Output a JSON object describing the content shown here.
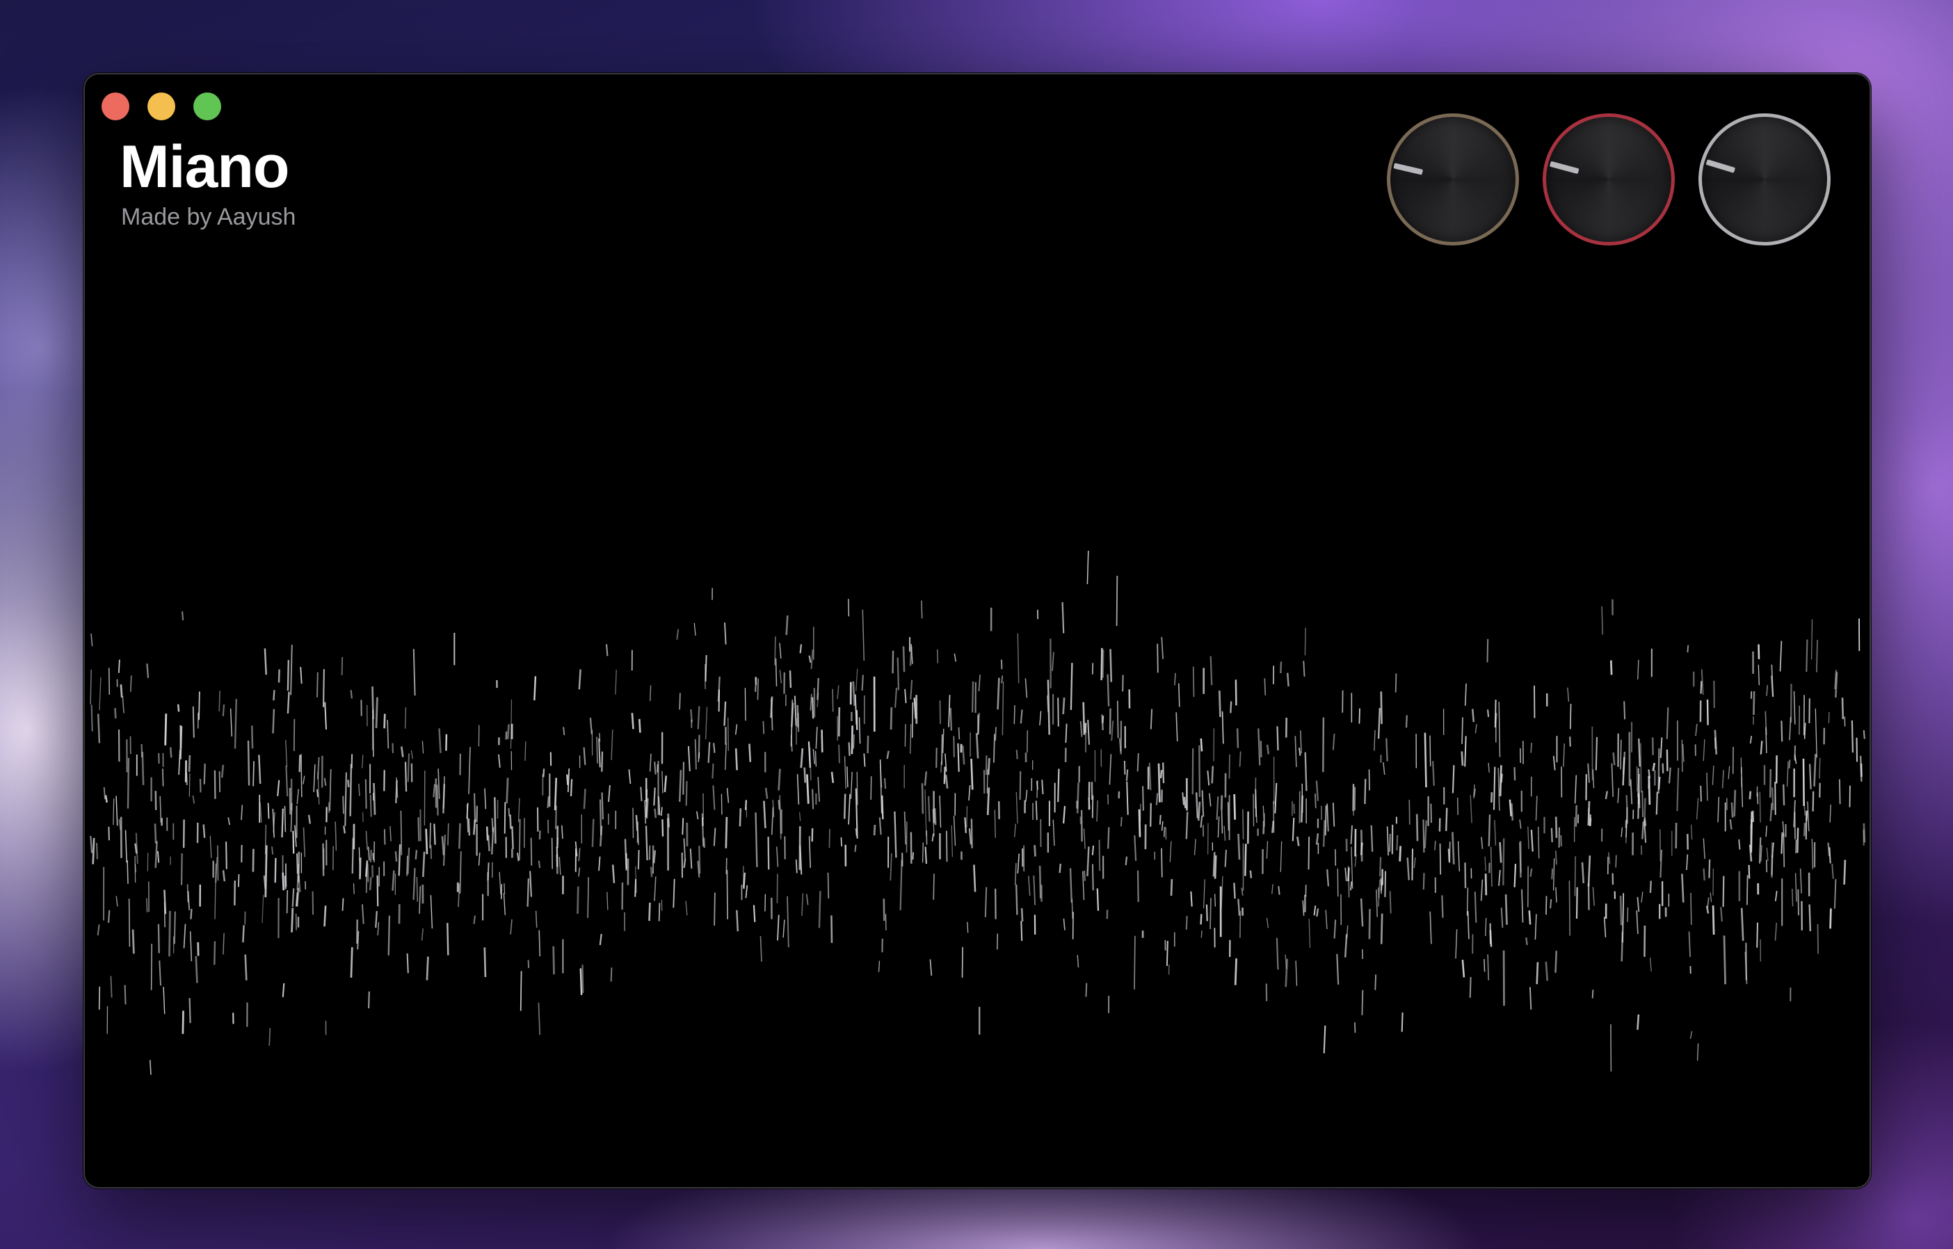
{
  "window": {
    "title": "Miano",
    "subtitle": "Made by Aayush"
  },
  "traffic_lights": [
    "close",
    "minimize",
    "zoom"
  ],
  "knobs": [
    {
      "name": "knob-1",
      "ring_color": "#7a6a55",
      "value": 0.22
    },
    {
      "name": "knob-2",
      "ring_color": "#a8323f",
      "value": 0.25
    },
    {
      "name": "knob-3",
      "ring_color": "#b0b0b4",
      "value": 0.28
    }
  ],
  "visualizer": {
    "stroke_color": "#d8d8dc",
    "background": "#000000"
  }
}
